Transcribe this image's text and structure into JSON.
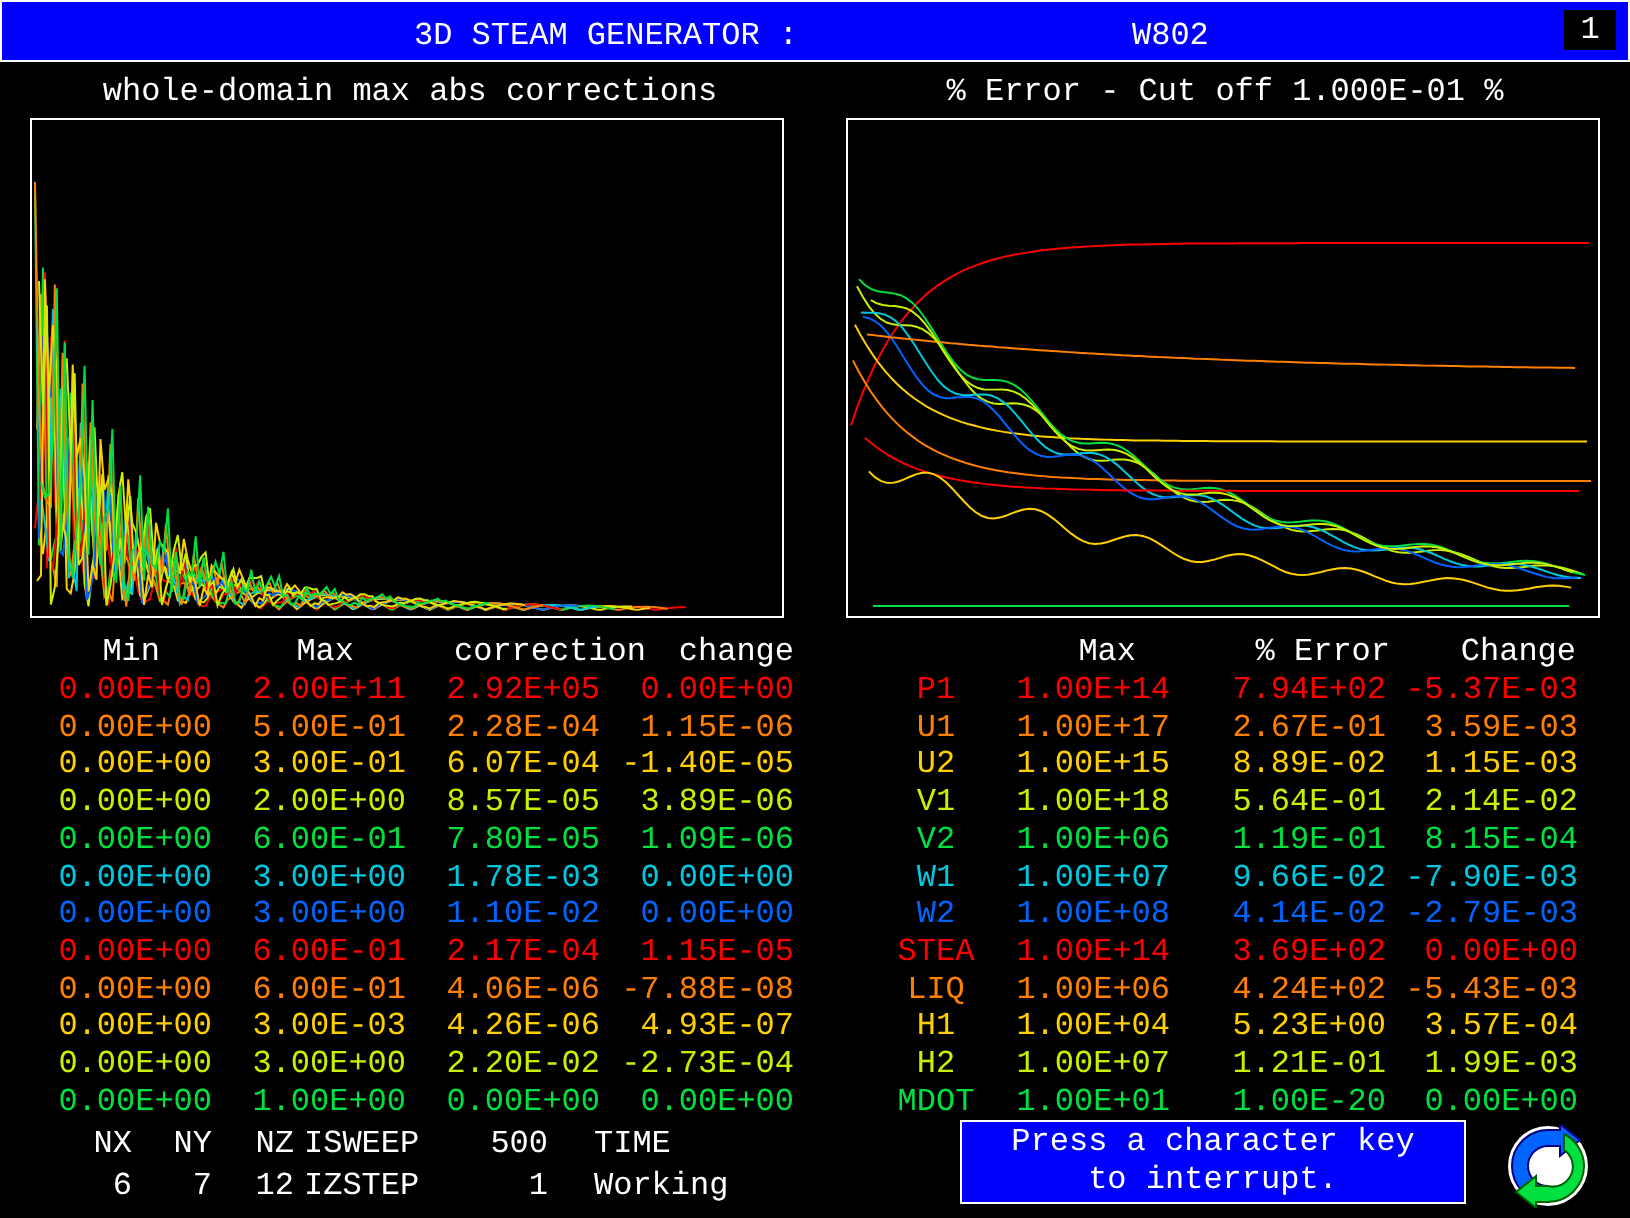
{
  "header": {
    "title": "3D STEAM GENERATOR :",
    "case": "W802",
    "badge": "1"
  },
  "left_panel": {
    "title": "whole-domain max abs corrections",
    "table": {
      "columns": [
        "Min",
        "Max",
        "correction",
        "change"
      ],
      "rows": [
        {
          "color": "#ff0000",
          "cells": [
            "0.00E+00",
            "2.00E+11",
            "2.92E+05",
            "0.00E+00"
          ]
        },
        {
          "color": "#ff8000",
          "cells": [
            "0.00E+00",
            "5.00E-01",
            "2.28E-04",
            "1.15E-06"
          ]
        },
        {
          "color": "#ffd000",
          "cells": [
            "0.00E+00",
            "3.00E-01",
            "6.07E-04",
            "-1.40E-05"
          ]
        },
        {
          "color": "#c8f000",
          "cells": [
            "0.00E+00",
            "2.00E+00",
            "8.57E-05",
            "3.89E-06"
          ]
        },
        {
          "color": "#00e040",
          "cells": [
            "0.00E+00",
            "6.00E-01",
            "7.80E-05",
            "1.09E-06"
          ]
        },
        {
          "color": "#00c8e0",
          "cells": [
            "0.00E+00",
            "3.00E+00",
            "1.78E-03",
            "0.00E+00"
          ]
        },
        {
          "color": "#0064ff",
          "cells": [
            "0.00E+00",
            "3.00E+00",
            "1.10E-02",
            "0.00E+00"
          ]
        },
        {
          "color": "#ff0000",
          "cells": [
            "0.00E+00",
            "6.00E-01",
            "2.17E-04",
            "1.15E-05"
          ]
        },
        {
          "color": "#ff8000",
          "cells": [
            "0.00E+00",
            "6.00E-01",
            "4.06E-06",
            "-7.88E-08"
          ]
        },
        {
          "color": "#ffd000",
          "cells": [
            "0.00E+00",
            "3.00E-03",
            "4.26E-06",
            "4.93E-07"
          ]
        },
        {
          "color": "#c8f000",
          "cells": [
            "0.00E+00",
            "3.00E+00",
            "2.20E-02",
            "-2.73E-04"
          ]
        },
        {
          "color": "#00e040",
          "cells": [
            "0.00E+00",
            "1.00E+00",
            "0.00E+00",
            "0.00E+00"
          ]
        }
      ]
    }
  },
  "right_panel": {
    "title": "% Error - Cut off 1.000E-01 %",
    "table": {
      "columns": [
        "Max",
        "% Error",
        "Change"
      ],
      "rows": [
        {
          "name": "P1",
          "color": "#ff0000",
          "cells": [
            "1.00E+14",
            "7.94E+02",
            "-5.37E-03"
          ]
        },
        {
          "name": "U1",
          "color": "#ff8000",
          "cells": [
            "1.00E+17",
            "2.67E-01",
            "3.59E-03"
          ]
        },
        {
          "name": "U2",
          "color": "#ffd000",
          "cells": [
            "1.00E+15",
            "8.89E-02",
            "1.15E-03"
          ]
        },
        {
          "name": "V1",
          "color": "#c8f000",
          "cells": [
            "1.00E+18",
            "5.64E-01",
            "2.14E-02"
          ]
        },
        {
          "name": "V2",
          "color": "#00e040",
          "cells": [
            "1.00E+06",
            "1.19E-01",
            "8.15E-04"
          ]
        },
        {
          "name": "W1",
          "color": "#00c8e0",
          "cells": [
            "1.00E+07",
            "9.66E-02",
            "-7.90E-03"
          ]
        },
        {
          "name": "W2",
          "color": "#0064ff",
          "cells": [
            "1.00E+08",
            "4.14E-02",
            "-2.79E-03"
          ]
        },
        {
          "name": "STEA",
          "color": "#ff0000",
          "cells": [
            "1.00E+14",
            "3.69E+02",
            "0.00E+00"
          ]
        },
        {
          "name": "LIQ",
          "color": "#ff8000",
          "cells": [
            "1.00E+06",
            "4.24E+02",
            "-5.43E-03"
          ]
        },
        {
          "name": "H1",
          "color": "#ffd000",
          "cells": [
            "1.00E+04",
            "5.23E+00",
            "3.57E-04"
          ]
        },
        {
          "name": "H2",
          "color": "#c8f000",
          "cells": [
            "1.00E+07",
            "1.21E-01",
            "1.99E-03"
          ]
        },
        {
          "name": "MDOT",
          "color": "#00e040",
          "cells": [
            "1.00E+01",
            "1.00E-20",
            "0.00E+00"
          ]
        }
      ]
    }
  },
  "status": {
    "rows": [
      [
        "NX",
        "NY",
        "NZ",
        "ISWEEP",
        "500",
        "TIME"
      ],
      [
        "6",
        "7",
        "12",
        "IZSTEP",
        "1",
        "Working"
      ]
    ]
  },
  "interrupt_message": [
    "Press a character key",
    "to interrupt."
  ]
}
